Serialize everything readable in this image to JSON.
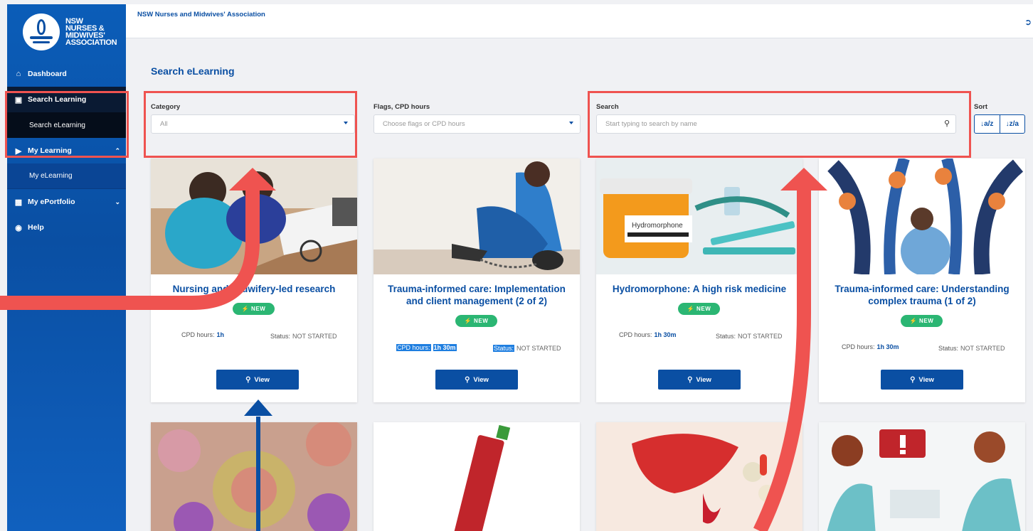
{
  "header": {
    "org_name": "NSW Nurses and Midwives' Association",
    "logout_icon": "logout-icon"
  },
  "logo": {
    "lines": [
      "NSW",
      "NURSES &",
      "MIDWIVES'",
      "ASSOCIATION"
    ]
  },
  "sidebar": {
    "dashboard": "Dashboard",
    "search_learning": "Search Learning",
    "search_elearning": "Search eLearning",
    "my_learning": "My Learning",
    "my_elearning": "My eLearning",
    "my_eportfolio": "My ePortfolio",
    "help": "Help"
  },
  "main": {
    "title": "Search eLearning",
    "category": {
      "label": "Category",
      "value": "All"
    },
    "flags": {
      "label": "Flags, CPD hours",
      "placeholder": "Choose flags or CPD hours"
    },
    "search": {
      "label": "Search",
      "placeholder": "Start typing to search by name"
    },
    "sort": {
      "label": "Sort",
      "asc": "↓a/z",
      "desc": "↓z/a"
    }
  },
  "cards": [
    {
      "title": "Nursing and Midwifery-led research",
      "badge": "NEW",
      "cpd_label": "CPD hours:",
      "cpd_value": "1h",
      "status_label": "Status:",
      "status_value": "NOT STARTED",
      "view": "View"
    },
    {
      "title": "Trauma-informed care: Implementation and client management (2 of 2)",
      "badge": "NEW",
      "cpd_label": "CPD hours:",
      "cpd_value": "1h 30m",
      "status_label": "Status:",
      "status_value": "NOT STARTED",
      "view": "View"
    },
    {
      "title": "Hydromorphone: A high risk medicine",
      "badge": "NEW",
      "cpd_label": "CPD hours:",
      "cpd_value": "1h 30m",
      "status_label": "Status:",
      "status_value": "NOT STARTED",
      "view": "View",
      "image_label": "Hydromorphone"
    },
    {
      "title": "Trauma-informed care: Understanding complex trauma (1 of 2)",
      "badge": "NEW",
      "cpd_label": "CPD hours:",
      "cpd_value": "1h 30m",
      "status_label": "Status:",
      "status_value": "NOT STARTED",
      "view": "View"
    }
  ],
  "colors": {
    "brand": "#0a4fa3",
    "badge_green": "#2bb673",
    "annotation_red": "#ef5350"
  }
}
